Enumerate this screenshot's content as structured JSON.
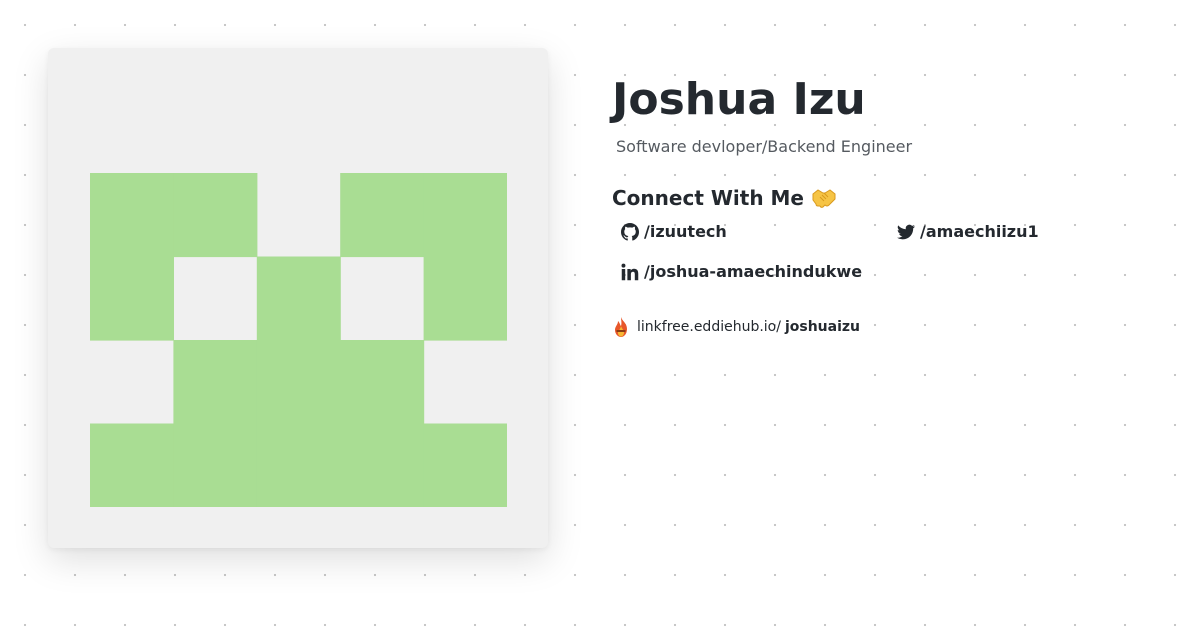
{
  "profile": {
    "name": "Joshua Izu",
    "tagline": "Software devloper/Backend Engineer"
  },
  "avatar": {
    "type": "identicon",
    "background_color": "#f0f0f0",
    "fill_color": "#a9dd93",
    "grid": [
      [
        1,
        1,
        0,
        1,
        1
      ],
      [
        1,
        0,
        1,
        0,
        1
      ],
      [
        0,
        1,
        1,
        1,
        0
      ],
      [
        1,
        1,
        1,
        1,
        1
      ]
    ]
  },
  "connect": {
    "heading": "Connect With Me",
    "heading_emoji": "handshake-icon",
    "links": [
      {
        "icon": "github-icon",
        "label": "/izuutech"
      },
      {
        "icon": "twitter-icon",
        "label": "/amaechiizu1"
      },
      {
        "icon": "linkedin-icon",
        "label": "/joshua-amaechindukwe"
      }
    ]
  },
  "linkfree": {
    "icon": "linkfree-flame-icon",
    "prefix": "linkfree.eddiehub.io/",
    "username": "joshuaizu"
  }
}
